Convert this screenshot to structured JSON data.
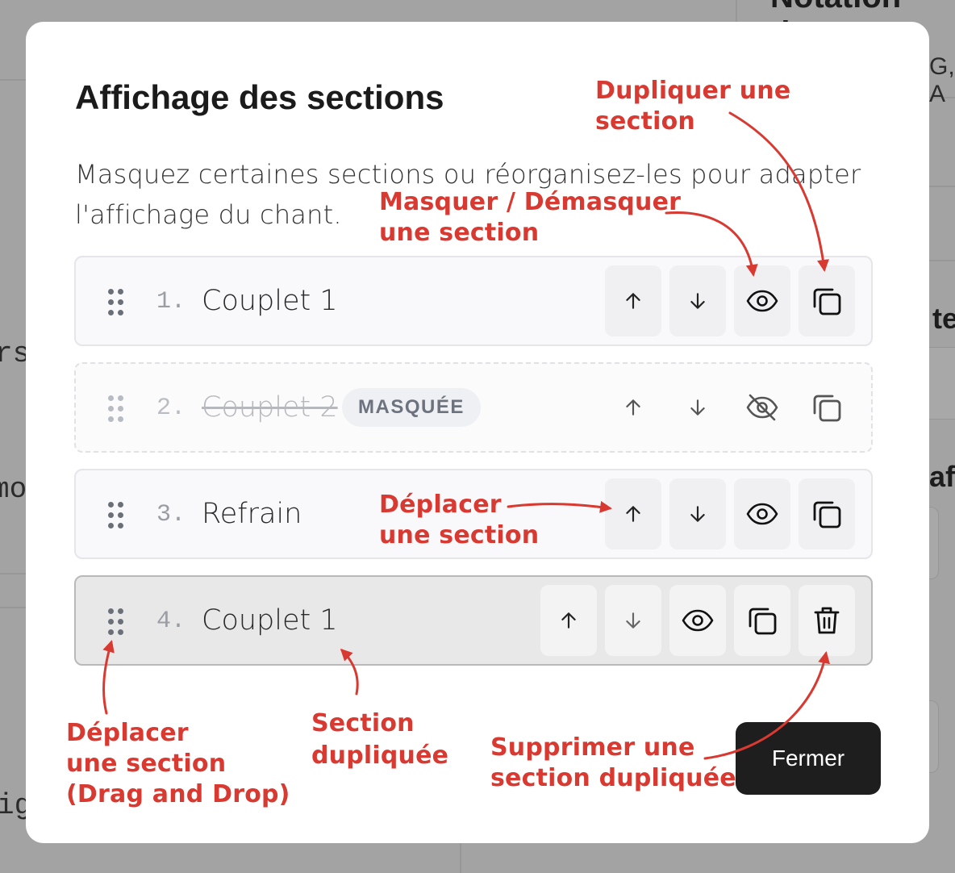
{
  "background": {
    "fragments": [
      "rs",
      "mo",
      "ig"
    ],
    "bold_fragments": [
      "Notation des",
      "G, A",
      "te",
      "aff"
    ]
  },
  "modal": {
    "title": "Affichage des sections",
    "description_line1": "Masquez certaines sections ou réorganisez-les pour adapter",
    "description_line2": "l'affichage du chant.",
    "close_label": "Fermer"
  },
  "sections": [
    {
      "number": "1.",
      "label": "Couplet 1",
      "state": "visible"
    },
    {
      "number": "2.",
      "label": "Couplet 2",
      "state": "hidden",
      "badge": "MASQUÉE"
    },
    {
      "number": "3.",
      "label": "Refrain",
      "state": "visible"
    },
    {
      "number": "4.",
      "label": "Couplet 1",
      "state": "duplicate"
    }
  ],
  "icons": {
    "handle": "drag-handle-icon",
    "up": "arrow-up-icon",
    "down": "arrow-down-icon",
    "eye": "eye-icon",
    "eye_off": "eye-off-icon",
    "copy": "copy-icon",
    "trash": "trash-icon"
  },
  "annotations": {
    "duplicate": [
      "Dupliquer une",
      "section"
    ],
    "toggle": [
      "Masquer / Démasquer",
      "une section"
    ],
    "move": [
      "Déplacer",
      "une section"
    ],
    "drag": [
      "Déplacer",
      "une section",
      "(Drag and Drop)"
    ],
    "duplicated": [
      "Section",
      "dupliquée"
    ],
    "delete": [
      "Supprimer une",
      "section dupliquée"
    ]
  },
  "colors": {
    "annotation": "#d83a32",
    "primary_button": "#1e1e1e",
    "overlay": "#a3a3a3"
  }
}
